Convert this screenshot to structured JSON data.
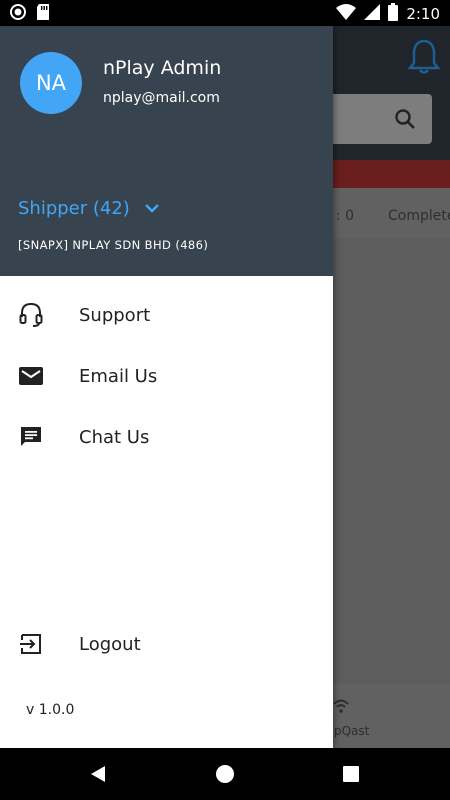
{
  "status_bar": {
    "time": "2:10",
    "icons": [
      "record-icon",
      "sd-card-icon",
      "wifi-icon",
      "signal-icon",
      "battery-icon"
    ]
  },
  "background_app": {
    "tabs": [
      ": 0",
      "Complete"
    ],
    "bottom_nav_label": "pQast",
    "icons": [
      "bell-icon",
      "search-icon",
      "wireless-icon"
    ]
  },
  "drawer": {
    "avatar_initials": "NA",
    "user_name": "nPlay Admin",
    "user_email": "nplay@mail.com",
    "role_label": "Shipper (42)",
    "company": "[SNAPX] NPLAY SDN BHD (486)",
    "menu": [
      {
        "label": "Support",
        "icon": "headset-icon"
      },
      {
        "label": "Email Us",
        "icon": "email-icon"
      },
      {
        "label": "Chat Us",
        "icon": "chat-icon"
      }
    ],
    "logout_label": "Logout",
    "version": "v 1.0.0"
  },
  "colors": {
    "header_bg": "#37434e",
    "accent": "#42a5f5",
    "drawer_bg": "#ffffff",
    "status_bar_bg": "#000000"
  }
}
